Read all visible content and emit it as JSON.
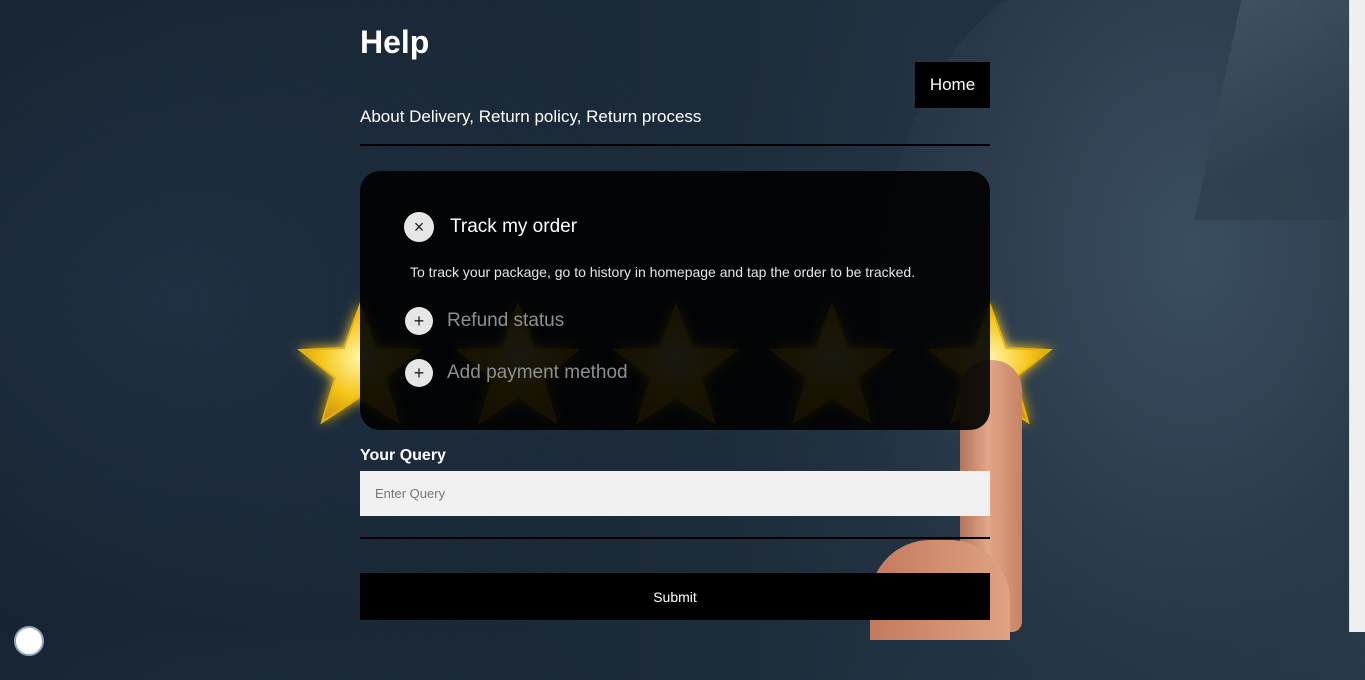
{
  "header": {
    "title": "Help",
    "subtitle": "About Delivery, Return policy, Return process",
    "home_label": "Home"
  },
  "faq": {
    "items": [
      {
        "question": "Track my order",
        "expanded": true,
        "toggle_icon": "close-icon",
        "toggle_glyph": "×",
        "answer": "To track your package, go to history in homepage and tap the order to be tracked."
      },
      {
        "question": "Refund status",
        "expanded": false,
        "toggle_icon": "plus-icon",
        "toggle_glyph": "+"
      },
      {
        "question": "Add payment method",
        "expanded": false,
        "toggle_icon": "plus-icon",
        "toggle_glyph": "+"
      }
    ]
  },
  "form": {
    "label": "Your Query",
    "placeholder": "Enter Query",
    "value": "",
    "submit_label": "Submit"
  },
  "colors": {
    "panel_bg": "#000000",
    "input_bg": "#f1f1f1",
    "star_gold": "#f5c518"
  }
}
